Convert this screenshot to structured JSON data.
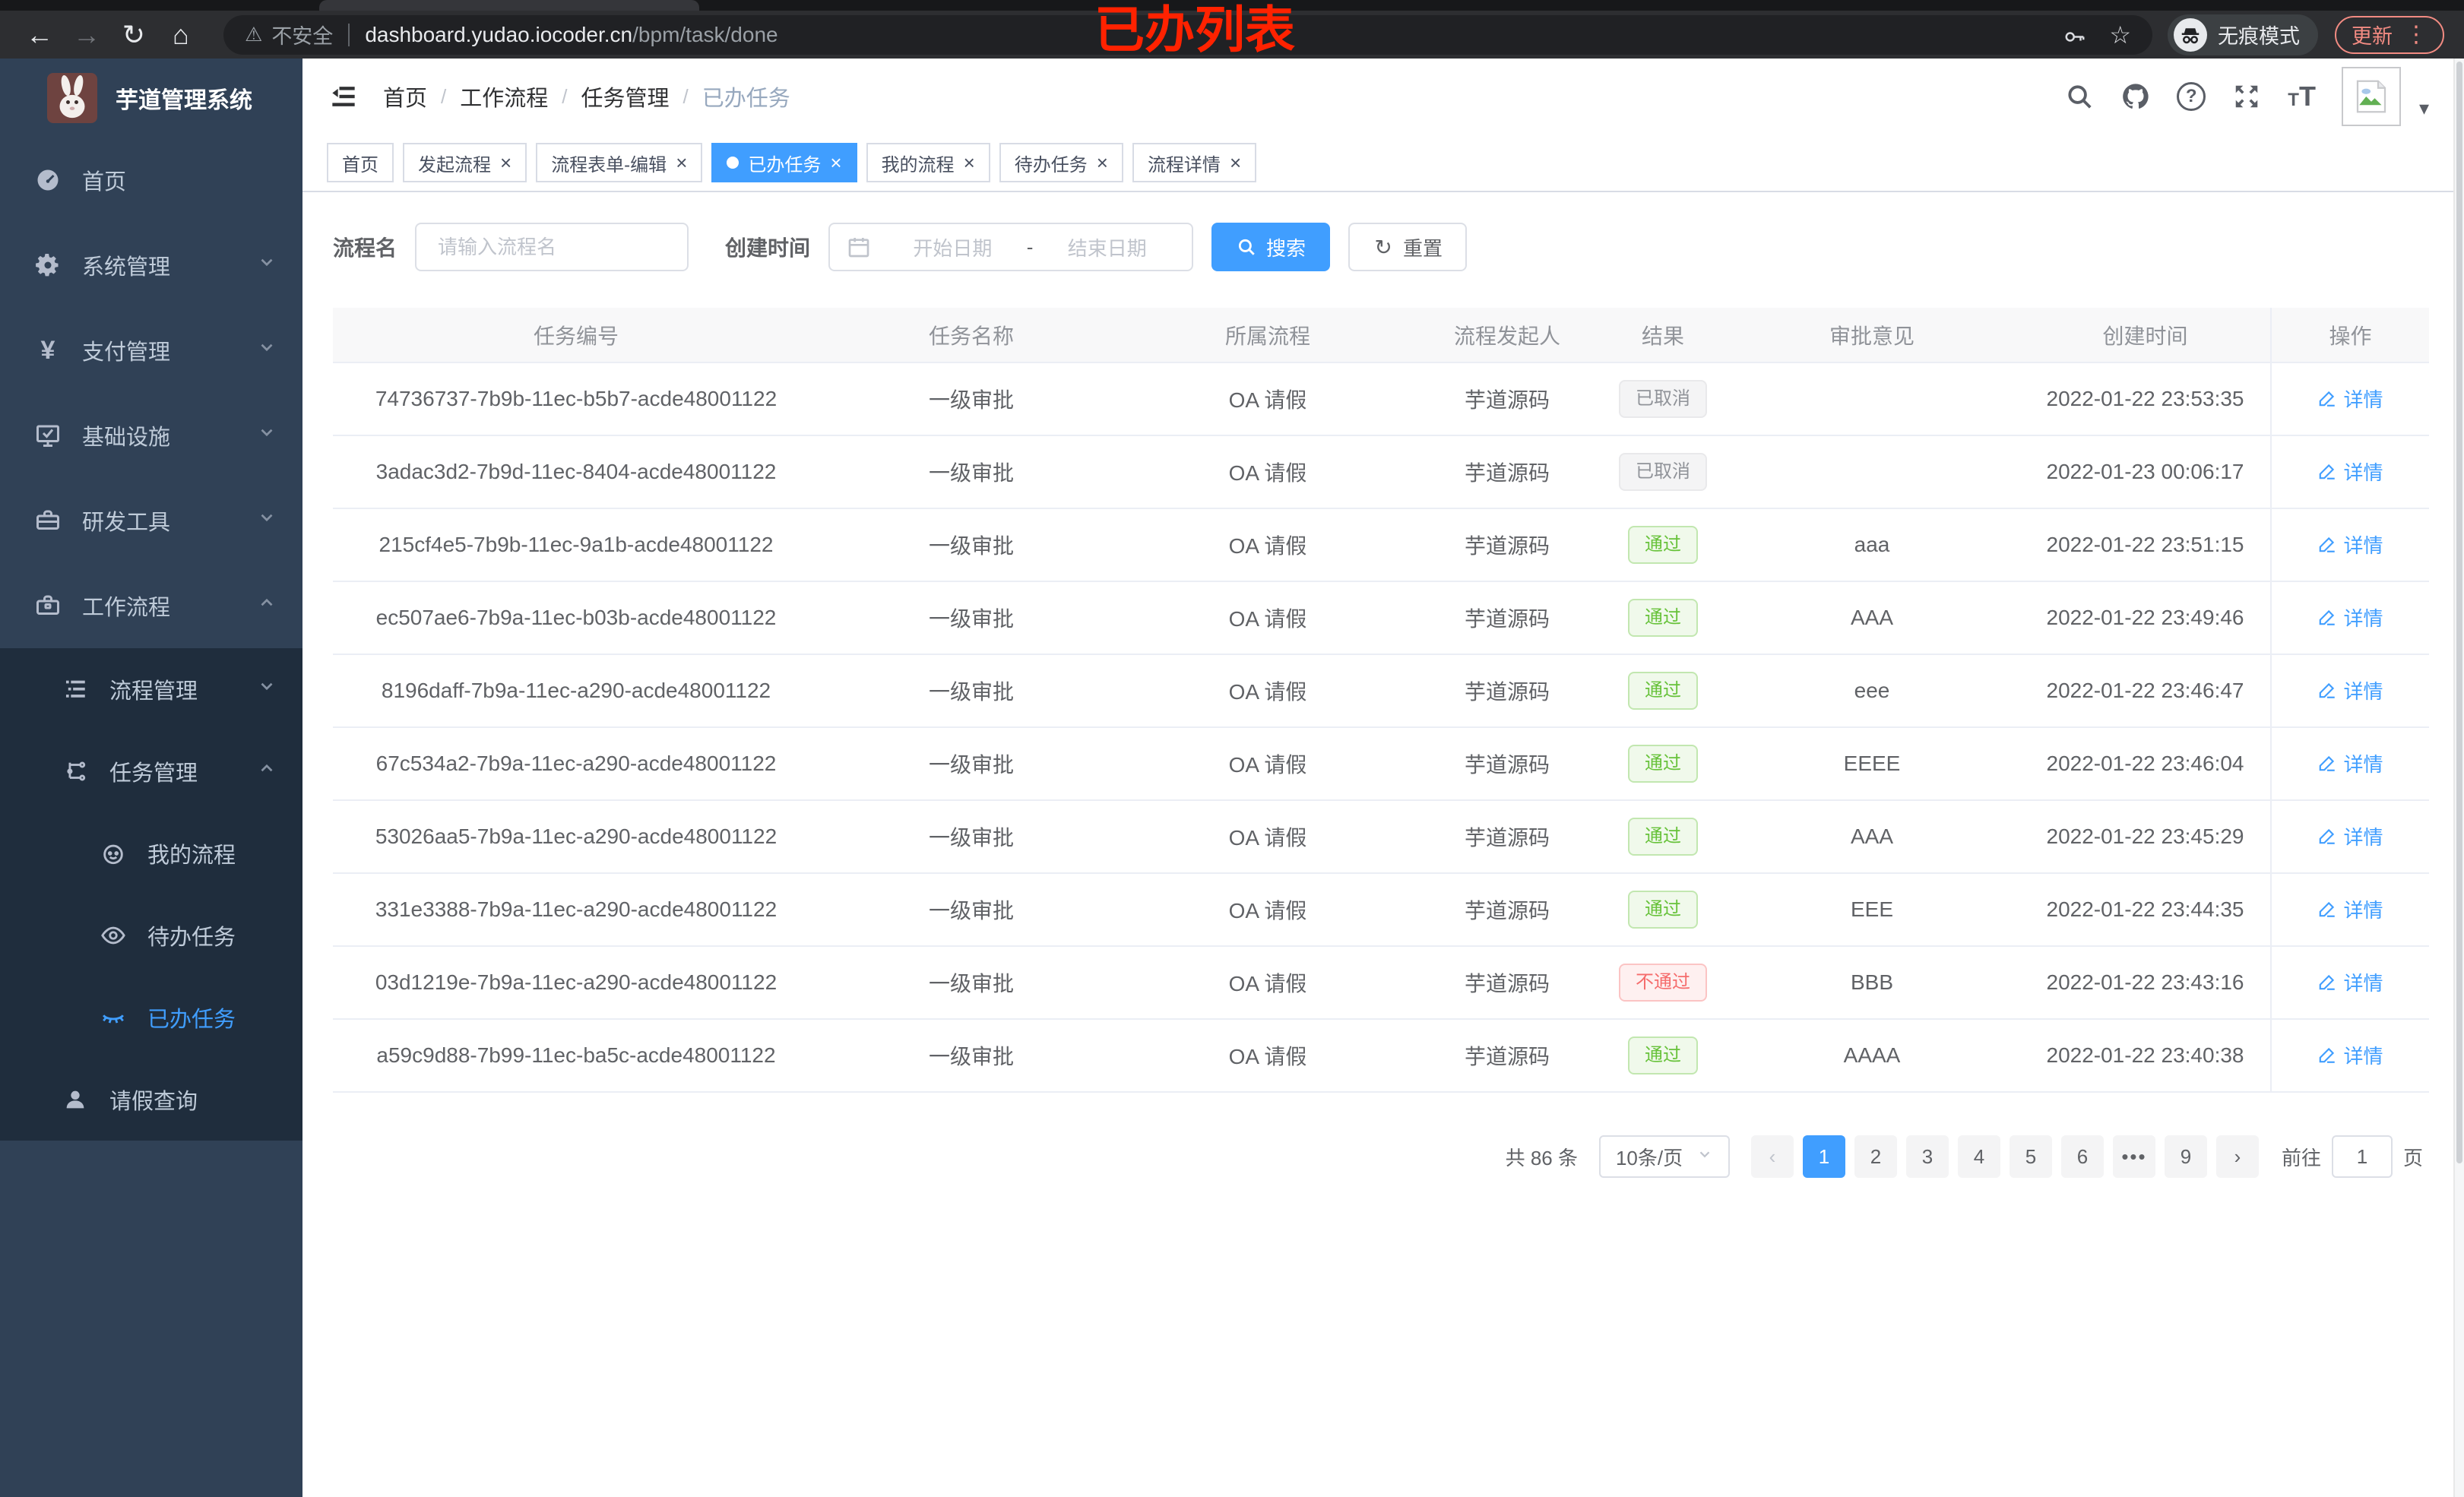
{
  "annotation": {
    "text": "已办列表",
    "color": "#ff2200"
  },
  "icons": {
    "back": "←",
    "forward": "→",
    "reload": "↻",
    "home": "⌂",
    "warning": "⚠",
    "star": "☆",
    "caret_down": "▾",
    "more_vertical": "⋮",
    "close": "×",
    "prev": "‹",
    "next": "›",
    "refresh": "↻"
  },
  "browser": {
    "security_text": "不安全",
    "url_host": "dashboard.yudao.iocoder.cn",
    "url_path": "/bpm/task/done",
    "incognito_label": "无痕模式",
    "update_label": "更新"
  },
  "sidebar": {
    "title": "芋道管理系统",
    "items": [
      {
        "label": "首页"
      },
      {
        "label": "系统管理"
      },
      {
        "label": "支付管理"
      },
      {
        "label": "基础设施"
      },
      {
        "label": "研发工具"
      },
      {
        "label": "工作流程"
      },
      {
        "label": "流程管理"
      },
      {
        "label": "任务管理"
      },
      {
        "label": "我的流程"
      },
      {
        "label": "待办任务"
      },
      {
        "label": "已办任务"
      },
      {
        "label": "请假查询"
      }
    ]
  },
  "header": {
    "breadcrumb": [
      "首页",
      "工作流程",
      "任务管理",
      "已办任务"
    ]
  },
  "tabs": [
    {
      "label": "首页"
    },
    {
      "label": "发起流程",
      "closable": true
    },
    {
      "label": "流程表单-编辑",
      "closable": true
    },
    {
      "label": "已办任务",
      "closable": true,
      "state": "active",
      "dot": true
    },
    {
      "label": "我的流程",
      "closable": true
    },
    {
      "label": "待办任务",
      "closable": true
    },
    {
      "label": "流程详情",
      "closable": true
    }
  ],
  "filters": {
    "name_label": "流程名",
    "name_placeholder": "请输入流程名",
    "date_label": "创建时间",
    "date_start": "开始日期",
    "date_separator": "-",
    "date_end": "结束日期",
    "search_label": "搜索",
    "reset_label": "重置"
  },
  "table": {
    "columns": [
      "任务编号",
      "任务名称",
      "所属流程",
      "流程发起人",
      "结果",
      "审批意见",
      "创建时间",
      "操作"
    ],
    "detail_label": "详情",
    "rows": [
      {
        "id": "74736737-7b9b-11ec-b5b7-acde48001122",
        "name": "一级审批",
        "process": "OA 请假",
        "starter": "芋道源码",
        "result": {
          "text": "已取消",
          "type": "info"
        },
        "opinion": "",
        "created": "2022-01-22 23:53:35"
      },
      {
        "id": "3adac3d2-7b9d-11ec-8404-acde48001122",
        "name": "一级审批",
        "process": "OA 请假",
        "starter": "芋道源码",
        "result": {
          "text": "已取消",
          "type": "info"
        },
        "opinion": "",
        "created": "2022-01-23 00:06:17"
      },
      {
        "id": "215cf4e5-7b9b-11ec-9a1b-acde48001122",
        "name": "一级审批",
        "process": "OA 请假",
        "starter": "芋道源码",
        "result": {
          "text": "通过",
          "type": "success"
        },
        "opinion": "aaa",
        "created": "2022-01-22 23:51:15"
      },
      {
        "id": "ec507ae6-7b9a-11ec-b03b-acde48001122",
        "name": "一级审批",
        "process": "OA 请假",
        "starter": "芋道源码",
        "result": {
          "text": "通过",
          "type": "success"
        },
        "opinion": "AAA",
        "created": "2022-01-22 23:49:46"
      },
      {
        "id": "8196daff-7b9a-11ec-a290-acde48001122",
        "name": "一级审批",
        "process": "OA 请假",
        "starter": "芋道源码",
        "result": {
          "text": "通过",
          "type": "success"
        },
        "opinion": "eee",
        "created": "2022-01-22 23:46:47"
      },
      {
        "id": "67c534a2-7b9a-11ec-a290-acde48001122",
        "name": "一级审批",
        "process": "OA 请假",
        "starter": "芋道源码",
        "result": {
          "text": "通过",
          "type": "success"
        },
        "opinion": "EEEE",
        "created": "2022-01-22 23:46:04"
      },
      {
        "id": "53026aa5-7b9a-11ec-a290-acde48001122",
        "name": "一级审批",
        "process": "OA 请假",
        "starter": "芋道源码",
        "result": {
          "text": "通过",
          "type": "success"
        },
        "opinion": "AAA",
        "created": "2022-01-22 23:45:29"
      },
      {
        "id": "331e3388-7b9a-11ec-a290-acde48001122",
        "name": "一级审批",
        "process": "OA 请假",
        "starter": "芋道源码",
        "result": {
          "text": "通过",
          "type": "success"
        },
        "opinion": "EEE",
        "created": "2022-01-22 23:44:35"
      },
      {
        "id": "03d1219e-7b9a-11ec-a290-acde48001122",
        "name": "一级审批",
        "process": "OA 请假",
        "starter": "芋道源码",
        "result": {
          "text": "不通过",
          "type": "danger"
        },
        "opinion": "BBB",
        "created": "2022-01-22 23:43:16"
      },
      {
        "id": "a59c9d88-7b99-11ec-ba5c-acde48001122",
        "name": "一级审批",
        "process": "OA 请假",
        "starter": "芋道源码",
        "result": {
          "text": "通过",
          "type": "success"
        },
        "opinion": "AAAA",
        "created": "2022-01-22 23:40:38"
      }
    ]
  },
  "pagination": {
    "total": "共 86 条",
    "page_size": "10条/页",
    "pages": [
      {
        "label": "1",
        "state": "active"
      },
      {
        "label": "2"
      },
      {
        "label": "3"
      },
      {
        "label": "4"
      },
      {
        "label": "5"
      },
      {
        "label": "6"
      },
      {
        "label": "•••",
        "state": "more"
      },
      {
        "label": "9"
      }
    ],
    "goto_label": "前往",
    "goto_value": "1",
    "goto_suffix": "页"
  }
}
